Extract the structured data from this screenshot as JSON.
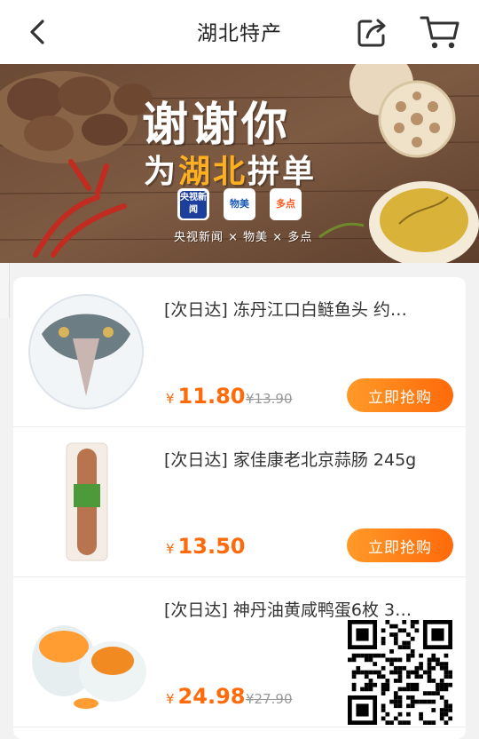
{
  "header": {
    "title": "湖北特产"
  },
  "banner": {
    "headline": "谢谢你",
    "subline_prefix": "为",
    "subline_highlight": "湖北",
    "subline_suffix": "拼单",
    "logo_cctv": "央视新闻",
    "logo_wumart": "物美",
    "logo_duodian": "多点",
    "partners": "央视新闻 × 物美 × 多点"
  },
  "products": [
    {
      "name": "[次日达] 冻丹江口白鲢鱼头 约…",
      "currency": "¥",
      "price": "11.80",
      "original_price": "¥13.90",
      "buy_label": "立即抢购"
    },
    {
      "name": "[次日达] 家佳康老北京蒜肠 245g",
      "currency": "¥",
      "price": "13.50",
      "original_price": "",
      "buy_label": "立即抢购"
    },
    {
      "name": "[次日达] 神丹油黄咸鸭蛋6枚 3…",
      "currency": "¥",
      "price": "24.98",
      "original_price": "¥27.90",
      "buy_label": ""
    }
  ],
  "colors": {
    "accent": "#ff6a0a",
    "background": "#f2f2f2"
  }
}
